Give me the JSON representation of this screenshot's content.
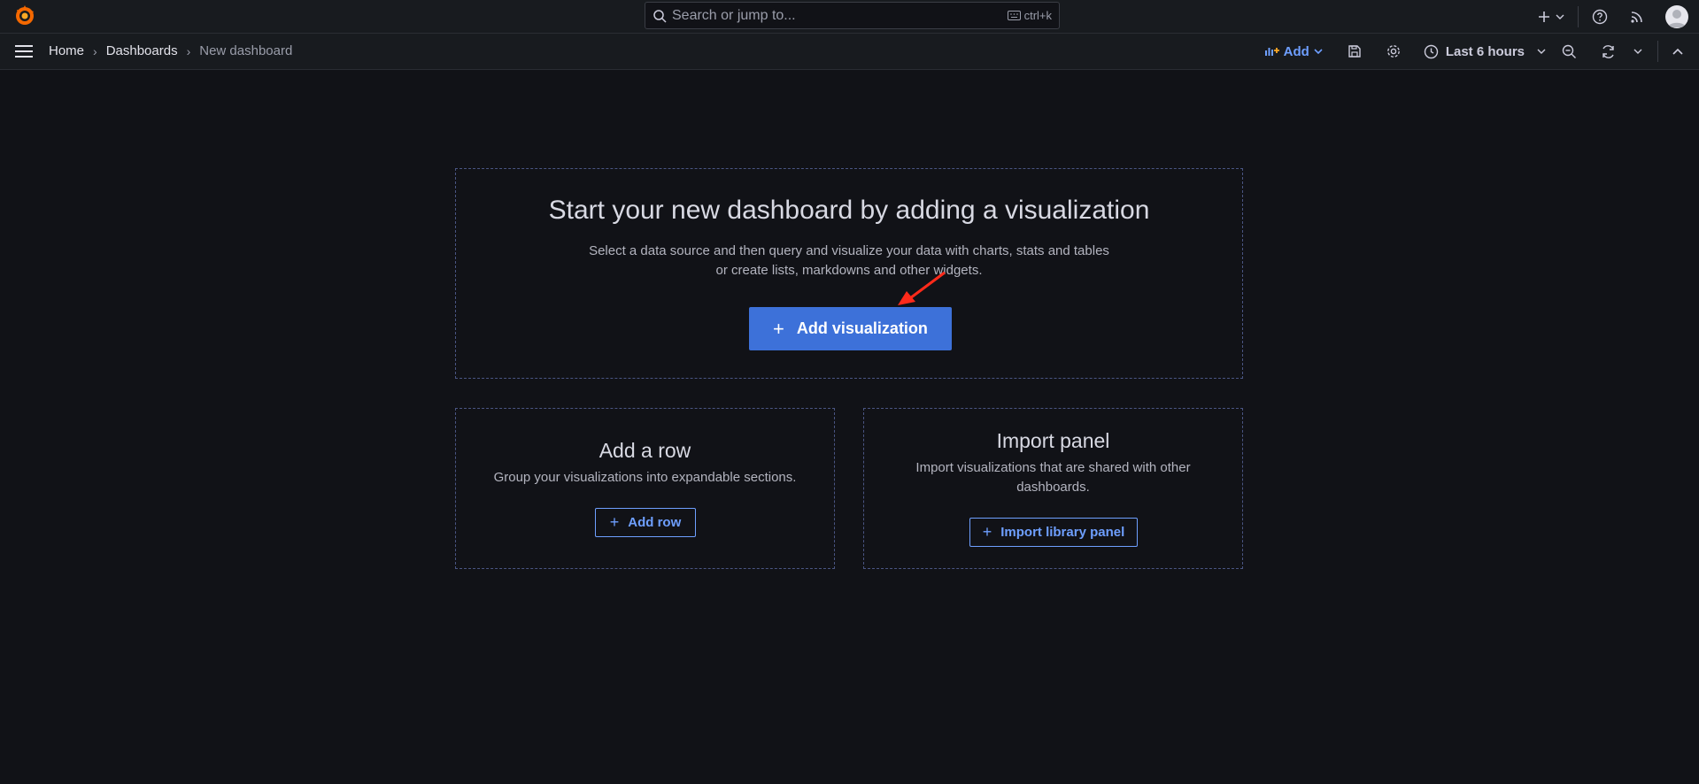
{
  "search": {
    "placeholder": "Search or jump to...",
    "shortcut": "ctrl+k"
  },
  "breadcrumb": {
    "home": "Home",
    "dashboards": "Dashboards",
    "current": "New dashboard"
  },
  "toolbar": {
    "add_label": "Add",
    "time_range": "Last 6 hours"
  },
  "main": {
    "title": "Start your new dashboard by adding a visualization",
    "desc_line1": "Select a data source and then query and visualize your data with charts, stats and tables",
    "desc_line2": "or create lists, markdowns and other widgets.",
    "button": "Add visualization"
  },
  "row_card": {
    "title": "Add a row",
    "desc": "Group your visualizations into expandable sections.",
    "button": "Add row"
  },
  "import_card": {
    "title": "Import panel",
    "desc_line1": "Import visualizations that are shared with other",
    "desc_line2": "dashboards.",
    "button": "Import library panel"
  },
  "colors": {
    "accent": "#3d71d9",
    "link": "#6e9fff",
    "background": "#111217",
    "panel": "#181b1f",
    "annotation_arrow": "#ff2a1a"
  }
}
